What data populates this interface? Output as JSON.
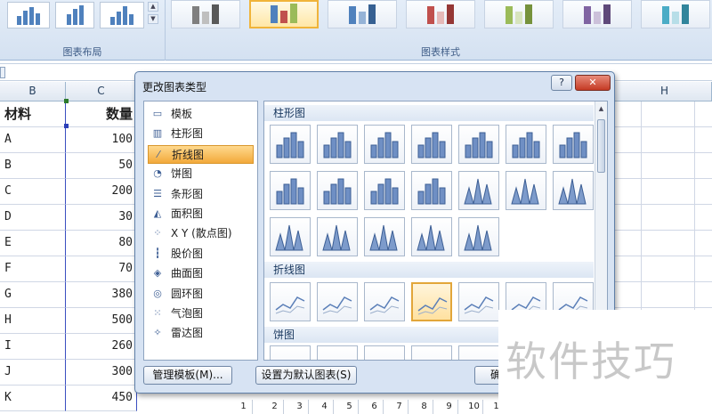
{
  "ribbon": {
    "layout_group_label": "图表布局",
    "style_group_label": "图表样式",
    "style_colors": [
      "#808080",
      "#4f81bd",
      "#c0504d",
      "#9bbb59",
      "#8064a2",
      "#4bacc6"
    ]
  },
  "sheet": {
    "col_b": "B",
    "col_c": "C",
    "col_h": "H",
    "header_b": "材料",
    "header_c": "数量",
    "rows": [
      {
        "b": "A",
        "c": "100"
      },
      {
        "b": "B",
        "c": "50"
      },
      {
        "b": "C",
        "c": "200"
      },
      {
        "b": "D",
        "c": "30"
      },
      {
        "b": "E",
        "c": "80"
      },
      {
        "b": "F",
        "c": "70"
      },
      {
        "b": "G",
        "c": "380"
      },
      {
        "b": "H",
        "c": "500"
      },
      {
        "b": "I",
        "c": "260"
      },
      {
        "b": "J",
        "c": "300"
      },
      {
        "b": "K",
        "c": "450"
      }
    ],
    "bottom_numbers": [
      "1",
      "2",
      "3",
      "4",
      "5",
      "6",
      "7",
      "8",
      "9",
      "10",
      "1"
    ]
  },
  "dialog": {
    "title": "更改图表类型",
    "help_label": "?",
    "close_label": "✕",
    "chart_types": [
      {
        "label": "模板",
        "icon": "folder-icon",
        "glyph": "▭"
      },
      {
        "label": "柱形图",
        "icon": "column-chart-icon",
        "glyph": "▥"
      },
      {
        "label": "折线图",
        "icon": "line-chart-icon",
        "glyph": "⁄",
        "selected": true
      },
      {
        "label": "饼图",
        "icon": "pie-chart-icon",
        "glyph": "◔"
      },
      {
        "label": "条形图",
        "icon": "bar-chart-icon",
        "glyph": "☰"
      },
      {
        "label": "面积图",
        "icon": "area-chart-icon",
        "glyph": "◭"
      },
      {
        "label": "X Y (散点图)",
        "icon": "scatter-chart-icon",
        "glyph": "⁘"
      },
      {
        "label": "股价图",
        "icon": "stock-chart-icon",
        "glyph": "┇"
      },
      {
        "label": "曲面图",
        "icon": "surface-chart-icon",
        "glyph": "◈"
      },
      {
        "label": "圆环图",
        "icon": "doughnut-chart-icon",
        "glyph": "◎"
      },
      {
        "label": "气泡图",
        "icon": "bubble-chart-icon",
        "glyph": "⁙"
      },
      {
        "label": "雷达图",
        "icon": "radar-chart-icon",
        "glyph": "✧"
      }
    ],
    "sections": {
      "column": "柱形图",
      "line": "折线图",
      "pie": "饼图"
    },
    "manage_templates_label": "管理模板(M)...",
    "set_default_label": "设置为默认图表(S)",
    "ok_label": "确定"
  },
  "watermark": "软件技巧"
}
